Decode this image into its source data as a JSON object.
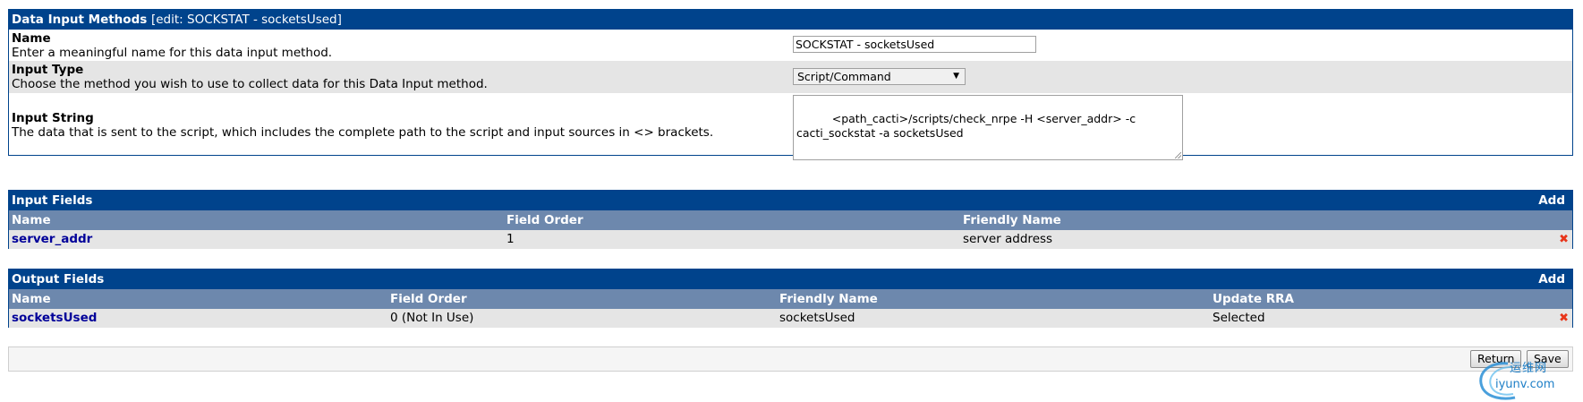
{
  "data_input_methods": {
    "title": "Data Input Methods",
    "subtitle": "[edit: SOCKSTAT - socketsUsed]",
    "fields": {
      "name": {
        "label": "Name",
        "description": "Enter a meaningful name for this data input method.",
        "value": "SOCKSTAT - socketsUsed"
      },
      "input_type": {
        "label": "Input Type",
        "description": "Choose the method you wish to use to collect data for this Data Input method.",
        "value": "Script/Command"
      },
      "input_string": {
        "label": "Input String",
        "description": "The data that is sent to the script, which includes the complete path to the script and input sources in <> brackets.",
        "value": "<path_cacti>/scripts/check_nrpe -H <server_addr> -c cacti_sockstat -a socketsUsed"
      }
    }
  },
  "input_fields": {
    "title": "Input Fields",
    "add_label": "Add",
    "columns": [
      "Name",
      "Field Order",
      "Friendly Name"
    ],
    "rows": [
      {
        "name": "server_addr",
        "field_order": "1",
        "friendly_name": "server address"
      }
    ]
  },
  "output_fields": {
    "title": "Output Fields",
    "add_label": "Add",
    "columns": [
      "Name",
      "Field Order",
      "Friendly Name",
      "Update RRA"
    ],
    "rows": [
      {
        "name": "socketsUsed",
        "field_order": "0 (Not In Use)",
        "friendly_name": "socketsUsed",
        "update_rra": "Selected"
      }
    ]
  },
  "actions": {
    "return_label": "Return",
    "save_label": "Save"
  },
  "watermark": {
    "text_cn": "运维网",
    "text_en": "iyunv.com"
  },
  "colors": {
    "header_bg": "#00438c",
    "table_head_bg": "#6d88ad",
    "row_bg": "#e5e5e5",
    "link": "#000099",
    "delete": "#e8351a"
  }
}
